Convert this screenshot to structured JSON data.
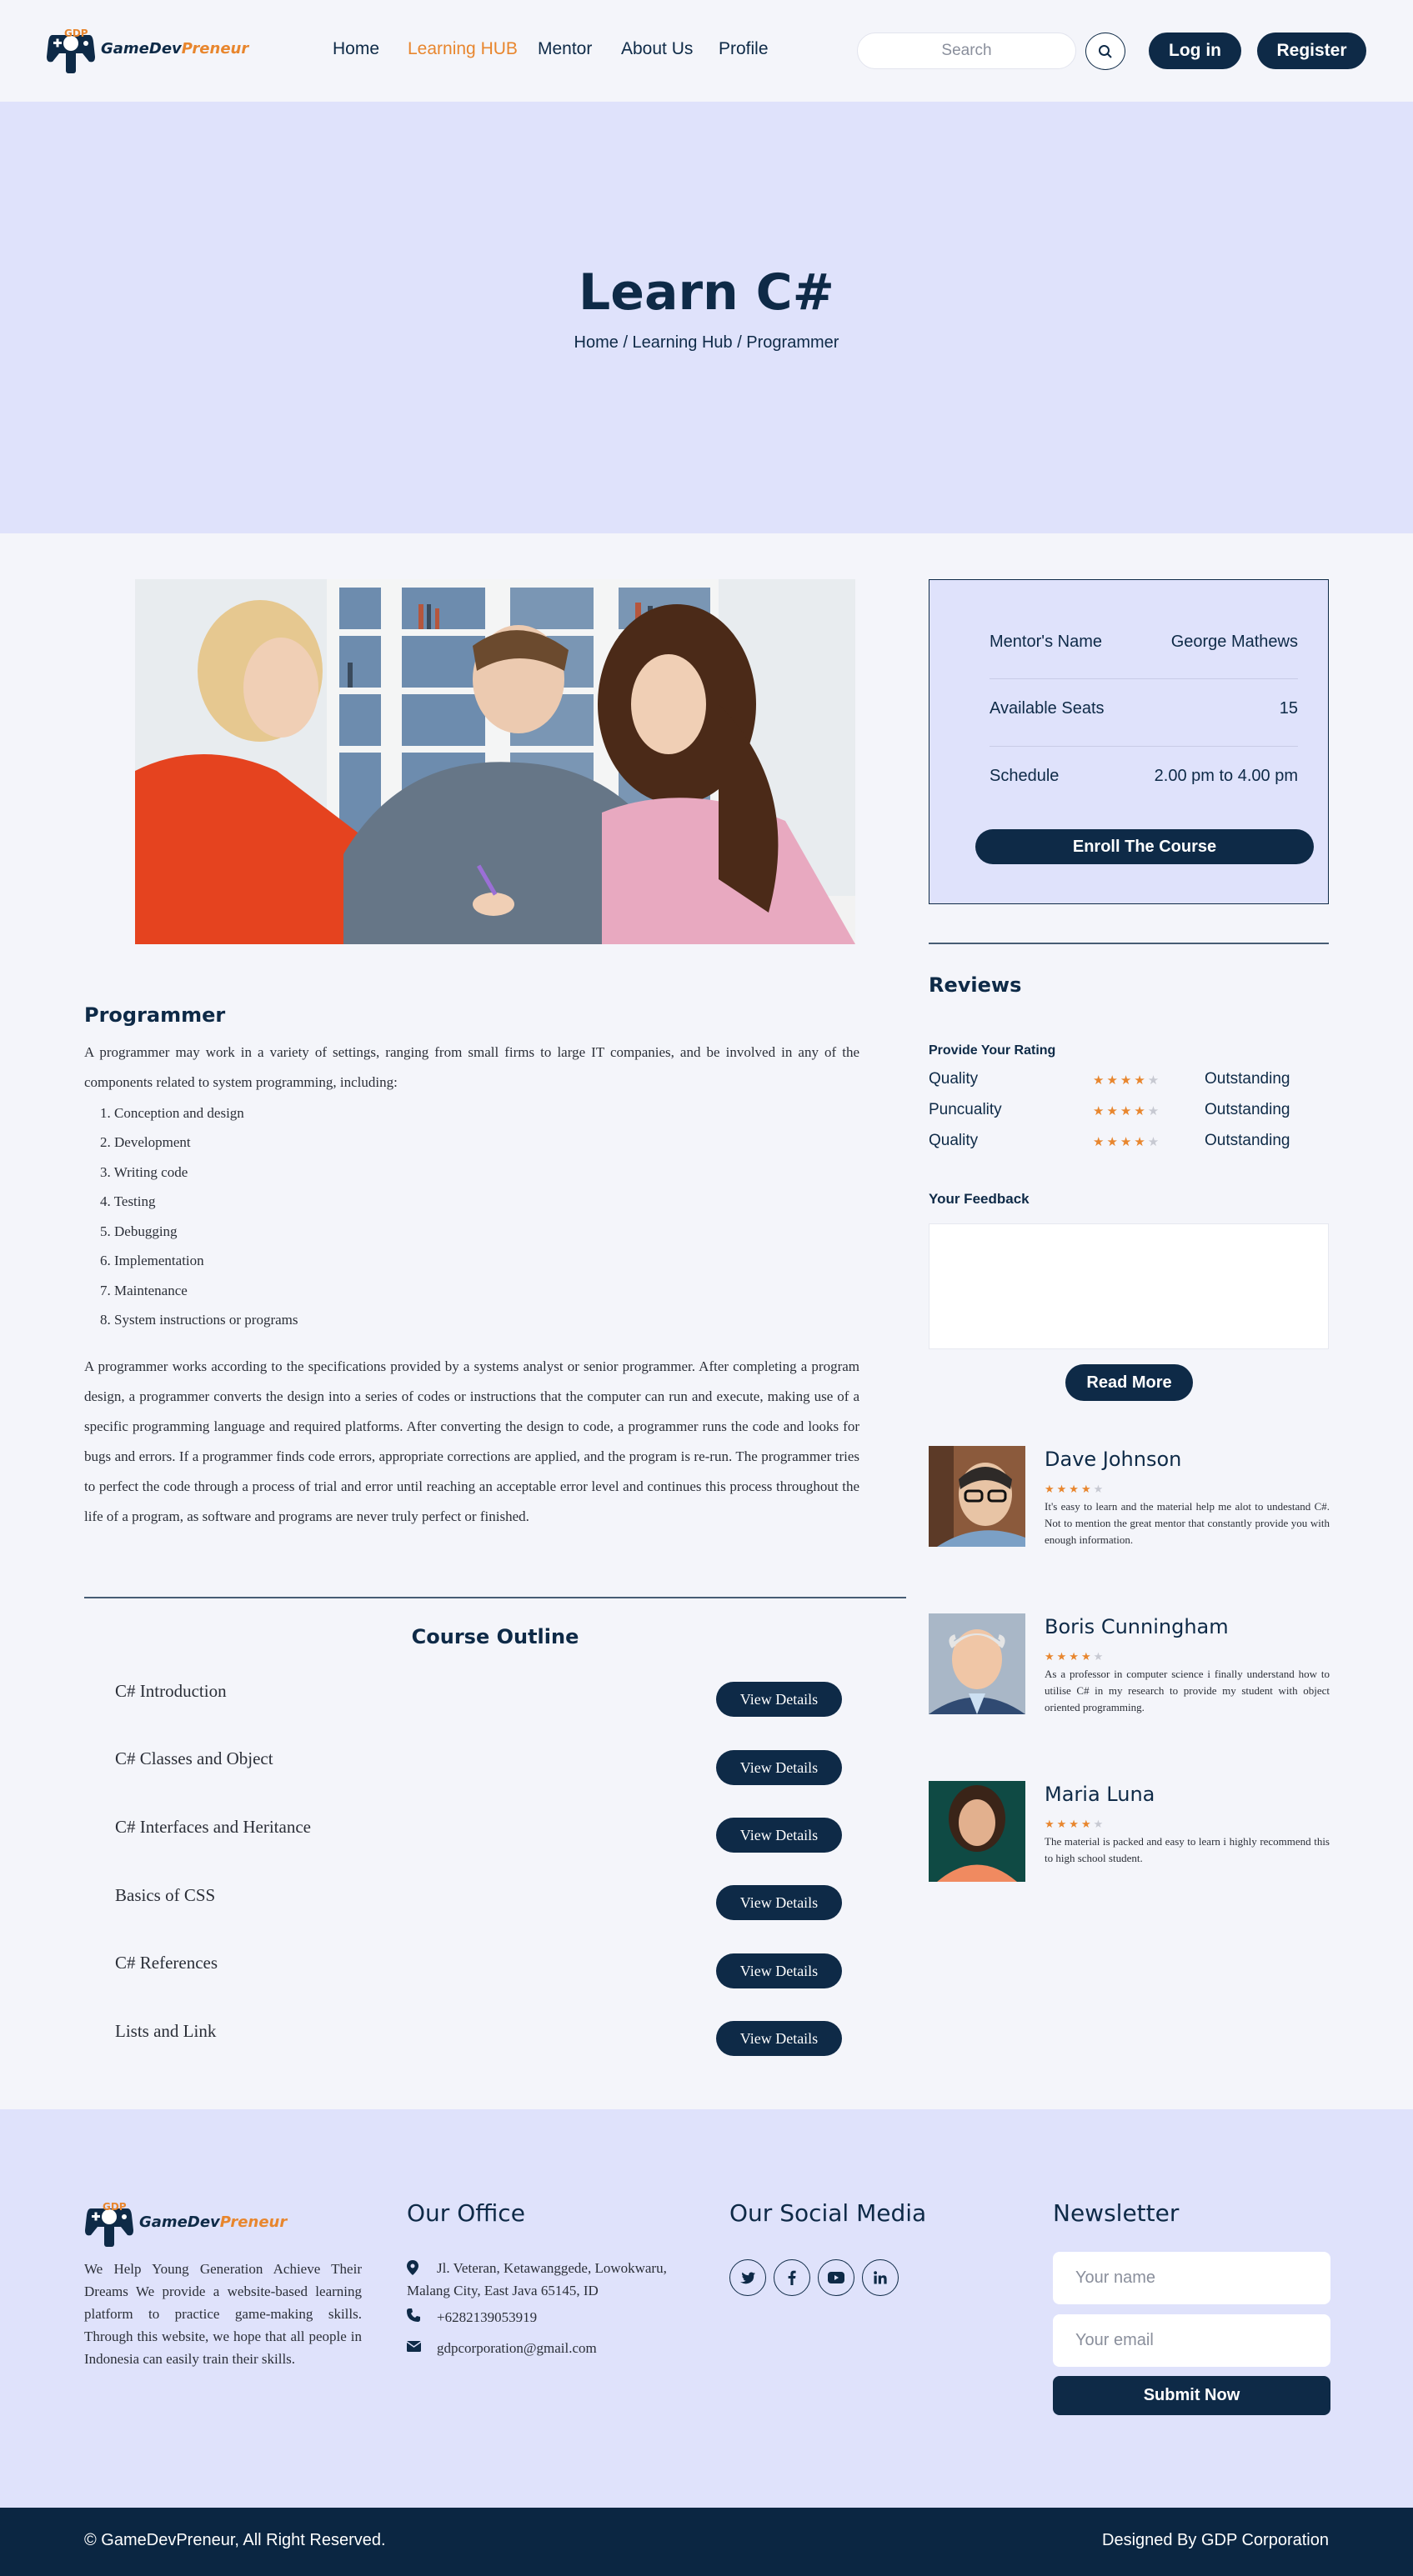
{
  "brand": {
    "name_part1": "GameDev",
    "name_part2": "Preneur",
    "primary_color": "#0e2a47",
    "accent_color": "#e8862e"
  },
  "nav": {
    "links": [
      "Home",
      "Learning HUB",
      "Mentor",
      "About Us",
      "Profile"
    ],
    "active": "Learning HUB",
    "search_placeholder": "Search",
    "login_label": "Log in",
    "register_label": "Register"
  },
  "hero": {
    "title": "Learn C#",
    "breadcrumb": "Home / Learning Hub / Programmer"
  },
  "course_info": {
    "mentor_label": "Mentor's Name",
    "mentor_value": "George Mathews",
    "seats_label": "Available Seats",
    "seats_value": "15",
    "schedule_label": "Schedule",
    "schedule_value": "2.00 pm to 4.00 pm",
    "enroll_label": "Enroll The Course"
  },
  "programmer": {
    "heading": "Programmer",
    "intro": "A programmer may work in a variety of settings, ranging from small firms to large IT companies, and be involved in any of the components related to system programming, including:",
    "items": [
      "Conception and design",
      "Development",
      "Writing code",
      "Testing",
      "Debugging",
      "Implementation",
      "Maintenance",
      "System instructions or programs"
    ],
    "body": "A programmer works according to the specifications provided by a systems analyst or senior programmer. After completing a program design, a programmer converts the design into a series of codes or instructions that the computer can run and execute, making use of a specific programming language and required platforms. After converting the design to code, a programmer runs the code and looks for bugs and errors. If a programmer finds code errors, appropriate corrections are applied, and the program is re-run. The programmer tries to perfect the code through a process of trial and error until reaching an acceptable error level and continues this process throughout the life of a program, as software and programs are never truly perfect or finished."
  },
  "outline": {
    "title": "Course Outline",
    "button_label": "View Details",
    "items": [
      "C# Introduction",
      "C# Classes and Object",
      "C# Interfaces and Heritance",
      "Basics of CSS",
      "C# References",
      "Lists and Link"
    ]
  },
  "reviews": {
    "heading": "Reviews",
    "rating_title": "Provide Your Rating",
    "ratings": [
      {
        "label": "Quality",
        "stars": 4,
        "value": "Outstanding"
      },
      {
        "label": "Puncuality",
        "stars": 4,
        "value": "Outstanding"
      },
      {
        "label": "Quality",
        "stars": 4,
        "value": "Outstanding"
      }
    ],
    "feedback_label": "Your Feedback",
    "read_more_label": "Read More",
    "items": [
      {
        "name": "Dave Johnson",
        "stars": 4,
        "text": "It's easy to learn and the material help me alot to undestand C#. Not to mention the great mentor that constantly provide you with enough information."
      },
      {
        "name": "Boris Cunningham",
        "stars": 4,
        "text": "As a professor in computer science i finally understand how to utilise C# in my research to provide my student with object oriented programming."
      },
      {
        "name": "Maria Luna",
        "stars": 4,
        "text": "The material is packed and easy to learn i highly recommend this to high school student."
      }
    ]
  },
  "footer": {
    "about": "We Help Young Generation Achieve Their Dreams We provide a website-based learning platform to practice game-making skills. Through this website, we hope that all people in Indonesia can easily train their skills.",
    "office_heading": "Our Office",
    "address": "Jl. Veteran, Ketawanggede, Lowokwaru, Malang City, East Java 65145, ID",
    "phone": "+6282139053919",
    "email": "gdpcorporation@gmail.com",
    "social_heading": "Our Social Media",
    "social_icons": [
      "twitter-icon",
      "facebook-icon",
      "youtube-icon",
      "linkedin-icon"
    ],
    "newsletter_heading": "Newsletter",
    "name_placeholder": "Your name",
    "email_placeholder": "Your email",
    "submit_label": "Submit Now",
    "copyright": "© GameDevPreneur, All Right Reserved.",
    "designed_by": "Designed By GDP Corporation"
  }
}
